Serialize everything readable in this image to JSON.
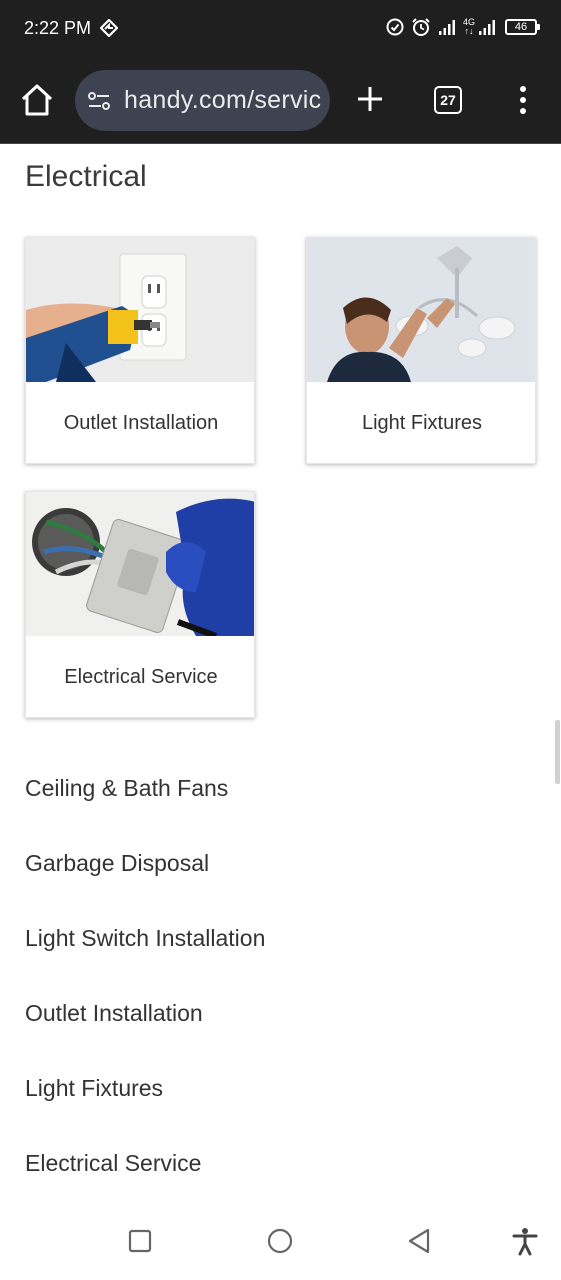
{
  "status_bar": {
    "time": "2:22 PM",
    "network_label_top": "4G",
    "network_label_bottom": "↑↓",
    "battery": "46"
  },
  "browser": {
    "url": "handy.com/servic",
    "tab_count": "27",
    "icons": [
      "home-icon",
      "site-settings-icon",
      "plus-icon",
      "tabs-icon",
      "more-vert-icon"
    ]
  },
  "page": {
    "section_title": "Electrical",
    "cards": [
      {
        "label": "Outlet Installation",
        "image": "drill-on-outlet-photo"
      },
      {
        "label": "Light Fixtures",
        "image": "man-installing-light-fixture-photo"
      },
      {
        "label": "Electrical Service",
        "image": "gloved-hand-wiring-outlet-photo"
      }
    ],
    "links": [
      "Ceiling & Bath Fans",
      "Garbage Disposal",
      "Light Switch Installation",
      "Outlet Installation",
      "Light Fixtures",
      "Electrical Service"
    ]
  },
  "nav_bar": {
    "icons": [
      "recents-square-icon",
      "home-circle-icon",
      "back-triangle-icon",
      "accessibility-icon"
    ]
  },
  "colors": {
    "toolbar_bg": "#1f1f1f",
    "url_bar_bg": "#3d4350",
    "text": "#333333"
  }
}
